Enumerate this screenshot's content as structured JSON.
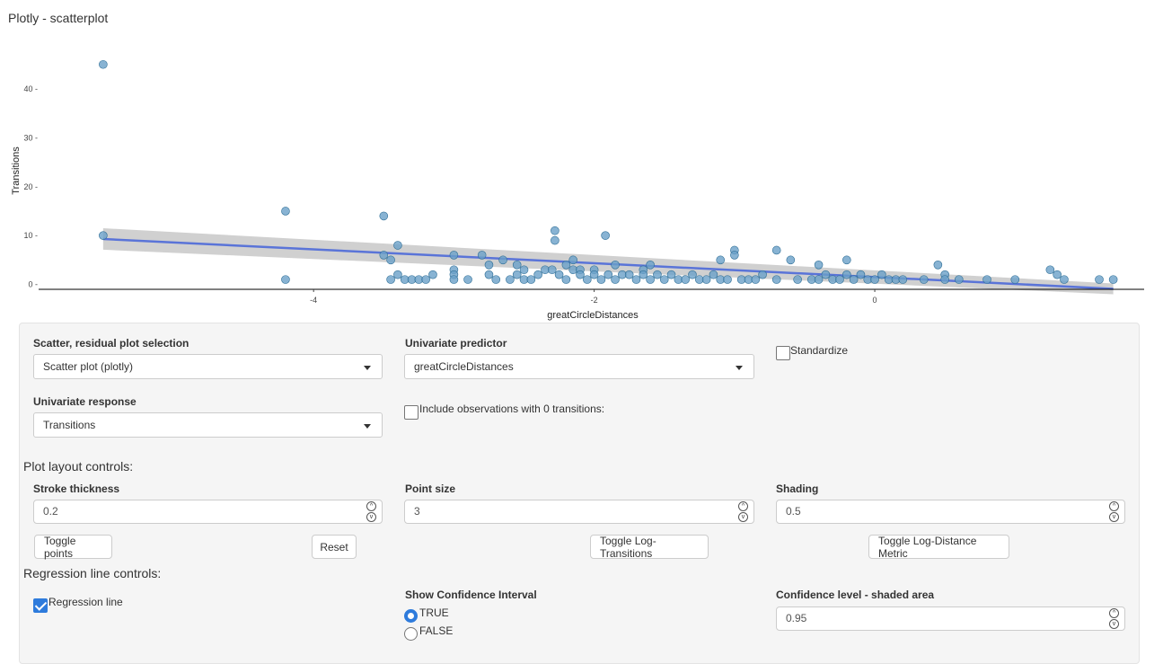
{
  "page": {
    "title": "Plotly - scatterplot"
  },
  "colors": {
    "points": "#6aa0c8",
    "point_stroke": "#2e6e96",
    "regression_line": "#5a74d8",
    "ci_band": "#c8c8c8",
    "accent": "#2e7bdc"
  },
  "chart_data": {
    "type": "scatter",
    "xlabel": "greatCircleDistances",
    "ylabel": "Transitions",
    "xlim": [
      -5.96,
      1.92
    ],
    "ylim": [
      -1,
      49
    ],
    "xticks": [
      -4,
      -2,
      0
    ],
    "yticks": [
      0,
      10,
      20,
      30,
      40
    ],
    "xtick_labels": [
      "-4",
      "-2",
      "0"
    ],
    "ytick_labels": [
      "0 -",
      "10 -",
      "20 -",
      "30 -",
      "40 -"
    ],
    "grid": false,
    "legend": "none",
    "points": [
      [
        -5.5,
        45
      ],
      [
        -5.5,
        10
      ],
      [
        -4.2,
        15
      ],
      [
        -4.2,
        1
      ],
      [
        -3.5,
        14
      ],
      [
        -3.5,
        6
      ],
      [
        -3.45,
        5
      ],
      [
        -3.45,
        1
      ],
      [
        -3.4,
        8
      ],
      [
        -3.4,
        2
      ],
      [
        -3.35,
        1
      ],
      [
        -3.3,
        1
      ],
      [
        -3.25,
        1
      ],
      [
        -3.2,
        1
      ],
      [
        -3.15,
        2
      ],
      [
        -3.0,
        6
      ],
      [
        -3.0,
        3
      ],
      [
        -3.0,
        2
      ],
      [
        -3.0,
        1
      ],
      [
        -2.9,
        1
      ],
      [
        -2.8,
        6
      ],
      [
        -2.75,
        4
      ],
      [
        -2.75,
        2
      ],
      [
        -2.7,
        1
      ],
      [
        -2.65,
        5
      ],
      [
        -2.6,
        1
      ],
      [
        -2.55,
        4
      ],
      [
        -2.55,
        2
      ],
      [
        -2.5,
        3
      ],
      [
        -2.5,
        1
      ],
      [
        -2.45,
        1
      ],
      [
        -2.4,
        2
      ],
      [
        -2.35,
        3
      ],
      [
        -2.3,
        3
      ],
      [
        -2.28,
        11
      ],
      [
        -2.28,
        9
      ],
      [
        -2.25,
        2
      ],
      [
        -2.2,
        4
      ],
      [
        -2.2,
        1
      ],
      [
        -2.15,
        5
      ],
      [
        -2.15,
        3
      ],
      [
        -2.1,
        3
      ],
      [
        -2.1,
        2
      ],
      [
        -2.05,
        1
      ],
      [
        -2.0,
        3
      ],
      [
        -2.0,
        2
      ],
      [
        -1.95,
        1
      ],
      [
        -1.92,
        10
      ],
      [
        -1.9,
        2
      ],
      [
        -1.85,
        4
      ],
      [
        -1.85,
        1
      ],
      [
        -1.8,
        2
      ],
      [
        -1.75,
        2
      ],
      [
        -1.7,
        1
      ],
      [
        -1.65,
        3
      ],
      [
        -1.65,
        2
      ],
      [
        -1.6,
        4
      ],
      [
        -1.6,
        1
      ],
      [
        -1.55,
        2
      ],
      [
        -1.5,
        1
      ],
      [
        -1.45,
        2
      ],
      [
        -1.4,
        1
      ],
      [
        -1.35,
        1
      ],
      [
        -1.3,
        2
      ],
      [
        -1.25,
        1
      ],
      [
        -1.2,
        1
      ],
      [
        -1.15,
        2
      ],
      [
        -1.1,
        5
      ],
      [
        -1.1,
        1
      ],
      [
        -1.05,
        1
      ],
      [
        -1.0,
        7
      ],
      [
        -1.0,
        6
      ],
      [
        -0.95,
        1
      ],
      [
        -0.9,
        1
      ],
      [
        -0.85,
        1
      ],
      [
        -0.8,
        2
      ],
      [
        -0.7,
        7
      ],
      [
        -0.7,
        1
      ],
      [
        -0.6,
        5
      ],
      [
        -0.55,
        1
      ],
      [
        -0.45,
        1
      ],
      [
        -0.4,
        4
      ],
      [
        -0.4,
        1
      ],
      [
        -0.35,
        2
      ],
      [
        -0.3,
        1
      ],
      [
        -0.25,
        1
      ],
      [
        -0.2,
        5
      ],
      [
        -0.2,
        2
      ],
      [
        -0.15,
        1
      ],
      [
        -0.1,
        2
      ],
      [
        -0.05,
        1
      ],
      [
        0.0,
        1
      ],
      [
        0.05,
        2
      ],
      [
        0.1,
        1
      ],
      [
        0.15,
        1
      ],
      [
        0.2,
        1
      ],
      [
        0.35,
        1
      ],
      [
        0.45,
        4
      ],
      [
        0.5,
        2
      ],
      [
        0.5,
        1
      ],
      [
        0.6,
        1
      ],
      [
        0.8,
        1
      ],
      [
        1.0,
        1
      ],
      [
        1.25,
        3
      ],
      [
        1.3,
        2
      ],
      [
        1.35,
        1
      ],
      [
        1.6,
        1
      ],
      [
        1.7,
        1
      ]
    ],
    "regression": {
      "x": [
        -5.5,
        1.7
      ],
      "y": [
        9.3,
        -0.9
      ],
      "ci_low": [
        7.1,
        -2.0
      ],
      "ci_high": [
        11.5,
        0.2
      ]
    }
  },
  "controls": {
    "scatter_select": {
      "label": "Scatter, residual plot selection",
      "value": "Scatter plot (plotly)"
    },
    "predictor_select": {
      "label": "Univariate predictor",
      "value": "greatCircleDistances"
    },
    "standardize": {
      "label": "Standardize",
      "checked": false
    },
    "response_select": {
      "label": "Univariate response",
      "value": "Transitions"
    },
    "include_zero": {
      "label": "Include observations with 0 transitions:",
      "checked": false
    },
    "plot_layout_heading": "Plot layout controls:",
    "stroke": {
      "label": "Stroke thickness",
      "value": "0.2"
    },
    "point_size": {
      "label": "Point size",
      "value": "3"
    },
    "shading": {
      "label": "Shading",
      "value": "0.5"
    },
    "toggle_points": "Toggle points",
    "reset": "Reset",
    "toggle_log_transitions": "Toggle Log-Transitions",
    "toggle_log_distance": "Toggle Log-Distance Metric",
    "regression_heading": "Regression line controls:",
    "regression_line": {
      "label": "Regression line",
      "checked": true
    },
    "show_ci": {
      "label": "Show Confidence Interval",
      "options": [
        "TRUE",
        "FALSE"
      ],
      "selected": "TRUE"
    },
    "conf_level": {
      "label": "Confidence level - shaded area",
      "value": "0.95"
    }
  }
}
